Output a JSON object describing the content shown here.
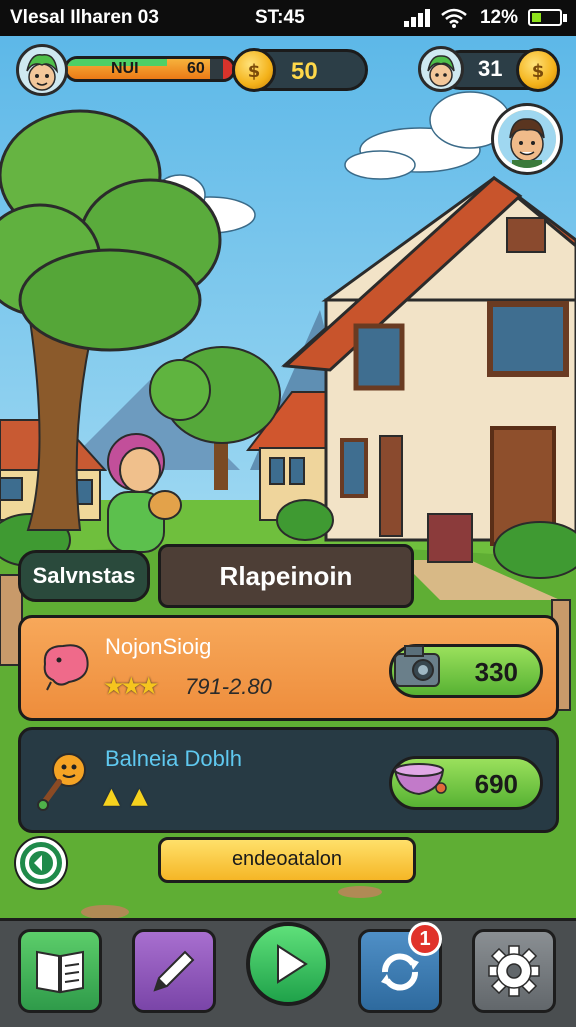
{
  "status_bar": {
    "carrier": "Vlesal Ilharen 03",
    "time": "ST:45",
    "battery": "12%",
    "battery_level": 0.3
  },
  "hud": {
    "player_label": "NUI",
    "player_value": "60",
    "xp_progress": 0.86,
    "coins": "50",
    "friend_count": "31"
  },
  "tabs": {
    "left": "Salvnstas",
    "right": "Rlapeinoin"
  },
  "cards": [
    {
      "title": "NojonSioig",
      "subtitle": "791-2.80",
      "stars": "★★★",
      "price": "330",
      "price_icon": "camera-icon",
      "icon": "pet-creature-icon"
    },
    {
      "title": "Balneia Doblh",
      "stars": "▲ ▲",
      "price": "690",
      "price_icon": "bowl-icon",
      "icon": "rattle-toy-icon"
    }
  ],
  "action_button": "endeoatalon",
  "nav": {
    "notification_count": "1",
    "items": [
      "book-icon",
      "pencil-icon",
      "play-icon",
      "refresh-icon",
      "gear-icon"
    ]
  },
  "colors": {
    "orange_card": "#f29a4a",
    "dark_card": "#273a44",
    "green_button": "#6bc43a",
    "sky": "#7cc8ec",
    "grass": "#6fbf3d"
  }
}
